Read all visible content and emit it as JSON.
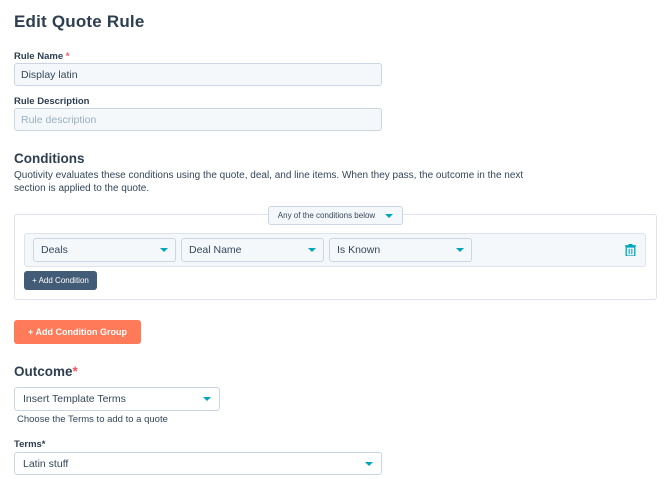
{
  "page": {
    "title": "Edit Quote Rule"
  },
  "rule_name": {
    "label": "Rule Name",
    "required_mark": "*",
    "value": "Display latin"
  },
  "rule_description": {
    "label": "Rule Description",
    "placeholder": "Rule description",
    "value": ""
  },
  "conditions": {
    "title": "Conditions",
    "help_line1": "Quotivity evaluates these conditions using the quote, deal, and line items. When they pass, the outcome in the next",
    "help_line2": "section is applied to the quote.",
    "logic_select": "Any of the conditions below",
    "row": {
      "object": "Deals",
      "property": "Deal Name",
      "operator": "Is Known"
    },
    "add_condition_label": "+ Add Condition",
    "add_group_label": "+ Add Condition Group"
  },
  "outcome": {
    "title": "Outcome",
    "required_mark": "*",
    "action": "Insert Template Terms",
    "help": "Choose the Terms to add to a quote",
    "terms_label": "Terms*",
    "terms_value": "Latin stuff"
  },
  "colors": {
    "accent": "#00a4bd",
    "primary_button": "#ff7a59",
    "secondary_button": "#425b76",
    "required": "#f2545b"
  },
  "icons": {
    "trash": "trash-icon",
    "caret": "caret-down-icon"
  }
}
